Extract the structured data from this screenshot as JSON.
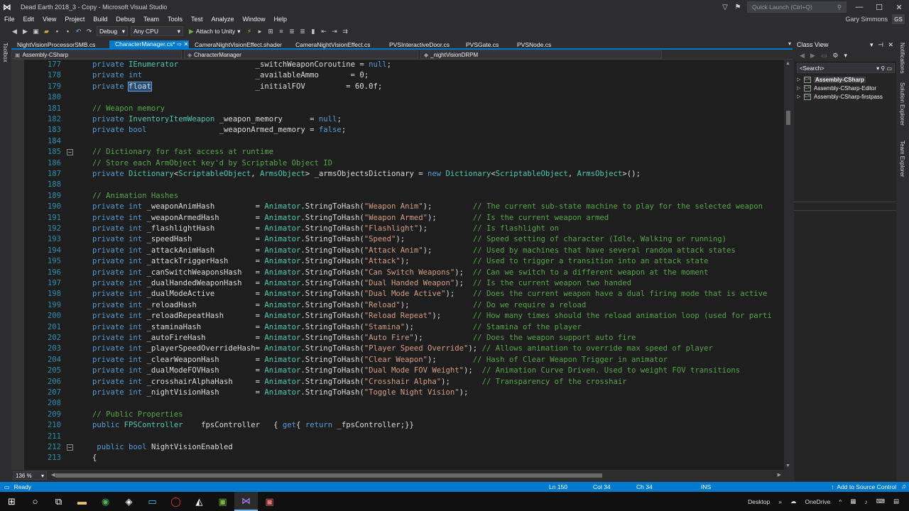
{
  "window": {
    "title": "Dead Earth 2018_3 - Copy - Microsoft Visual Studio",
    "quick_launch_placeholder": "Quick Launch (Ctrl+Q)",
    "user_name": "Gary Simmons",
    "user_initials": "GS"
  },
  "menu": [
    "File",
    "Edit",
    "View",
    "Project",
    "Build",
    "Debug",
    "Team",
    "Tools",
    "Test",
    "Analyze",
    "Window",
    "Help"
  ],
  "toolbar": {
    "config": "Debug",
    "platform": "Any CPU",
    "attach_label": "Attach to Unity"
  },
  "toolbox_label": "Toolbox",
  "tabs": [
    {
      "label": "NightVisionProcessorSMB.cs",
      "active": false
    },
    {
      "label": "CharacterManager.cs*  ⇨  ✕",
      "active": true
    },
    {
      "label": "CameraNightVisionEffect.shader",
      "active": false
    },
    {
      "label": "CameraNightVisionEffect.cs",
      "active": false
    },
    {
      "label": "PVSInteractiveDoor.cs",
      "active": false
    },
    {
      "label": "PVSGate.cs",
      "active": false
    },
    {
      "label": "PVSNode.cs",
      "active": false
    }
  ],
  "navbar": {
    "project": "Assembly-CSharp",
    "type": "CharacterManager",
    "member": "_nightVisionDRPM"
  },
  "code_lines": [
    {
      "n": "177",
      "segs": [
        [
          "kw",
          "private "
        ],
        [
          "tp",
          "IEnumerator"
        ],
        [
          "t",
          "                 _switchWeaponCoroutine = "
        ],
        [
          "kw",
          "null"
        ],
        [
          "t",
          ";"
        ]
      ]
    },
    {
      "n": "178",
      "segs": [
        [
          "kw",
          "private int"
        ],
        [
          "t",
          "                         _availableAmmo       = 0;"
        ]
      ]
    },
    {
      "n": "179",
      "segs": [
        [
          "kw",
          "private "
        ],
        [
          "sel",
          "float"
        ],
        [
          "t",
          "                       _initialFOV         = 60.0f;"
        ]
      ]
    },
    {
      "n": "180",
      "segs": []
    },
    {
      "n": "181",
      "segs": [
        [
          "cm",
          "// Weapon memory"
        ]
      ]
    },
    {
      "n": "182",
      "segs": [
        [
          "kw",
          "private "
        ],
        [
          "tp",
          "InventoryItemWeapon"
        ],
        [
          "t",
          " _weapon_memory      = "
        ],
        [
          "kw",
          "null"
        ],
        [
          "t",
          ";"
        ]
      ]
    },
    {
      "n": "183",
      "segs": [
        [
          "kw",
          "private bool"
        ],
        [
          "t",
          "                _weaponArmed_memory = "
        ],
        [
          "kw",
          "false"
        ],
        [
          "t",
          ";"
        ]
      ]
    },
    {
      "n": "184",
      "segs": []
    },
    {
      "n": "185",
      "fold": true,
      "segs": [
        [
          "cm",
          "// Dictionary for fast access at runtime"
        ]
      ]
    },
    {
      "n": "186",
      "segs": [
        [
          "cm",
          "// Store each ArmObject key'd by Scriptable Object ID"
        ]
      ]
    },
    {
      "n": "187",
      "segs": [
        [
          "kw",
          "private "
        ],
        [
          "tp",
          "Dictionary"
        ],
        [
          "t",
          "<"
        ],
        [
          "tp",
          "ScriptableObject"
        ],
        [
          "t",
          ", "
        ],
        [
          "tp",
          "ArmsObject"
        ],
        [
          "t",
          "> _armsObjectsDictionary = "
        ],
        [
          "kw",
          "new "
        ],
        [
          "tp",
          "Dictionary"
        ],
        [
          "t",
          "<"
        ],
        [
          "tp",
          "ScriptableObject"
        ],
        [
          "t",
          ", "
        ],
        [
          "tp",
          "ArmsObject"
        ],
        [
          "t",
          ">();"
        ]
      ]
    },
    {
      "n": "188",
      "segs": []
    },
    {
      "n": "189",
      "segs": [
        [
          "cm",
          "// Animation Hashes"
        ]
      ]
    },
    {
      "n": "190",
      "segs": [
        [
          "kw",
          "private int"
        ],
        [
          "t",
          " _weaponAnimHash         = "
        ],
        [
          "tp",
          "Animator"
        ],
        [
          "t",
          ".StringToHash("
        ],
        [
          "str",
          "\"Weapon Anim\""
        ],
        [
          "t",
          ");         "
        ],
        [
          "cm",
          "// The current sub-state machine to play for the selected weapon"
        ]
      ]
    },
    {
      "n": "191",
      "segs": [
        [
          "kw",
          "private int"
        ],
        [
          "t",
          " _weaponArmedHash        = "
        ],
        [
          "tp",
          "Animator"
        ],
        [
          "t",
          ".StringToHash("
        ],
        [
          "str",
          "\"Weapon Armed\""
        ],
        [
          "t",
          ");        "
        ],
        [
          "cm",
          "// Is the current weapon armed"
        ]
      ]
    },
    {
      "n": "192",
      "segs": [
        [
          "kw",
          "private int"
        ],
        [
          "t",
          " _flashlightHash         = "
        ],
        [
          "tp",
          "Animator"
        ],
        [
          "t",
          ".StringToHash("
        ],
        [
          "str",
          "\"Flashlight\""
        ],
        [
          "t",
          ");          "
        ],
        [
          "cm",
          "// Is flashlight on"
        ]
      ]
    },
    {
      "n": "193",
      "segs": [
        [
          "kw",
          "private int"
        ],
        [
          "t",
          " _speedHash              = "
        ],
        [
          "tp",
          "Animator"
        ],
        [
          "t",
          ".StringToHash("
        ],
        [
          "str",
          "\"Speed\""
        ],
        [
          "t",
          ");               "
        ],
        [
          "cm",
          "// Speed setting of character (Idle, Walking or running)"
        ]
      ]
    },
    {
      "n": "194",
      "segs": [
        [
          "kw",
          "private int"
        ],
        [
          "t",
          " _attackAnimHash         = "
        ],
        [
          "tp",
          "Animator"
        ],
        [
          "t",
          ".StringToHash("
        ],
        [
          "str",
          "\"Attack Anim\""
        ],
        [
          "t",
          ");         "
        ],
        [
          "cm",
          "// Used by machines that have several random attack states"
        ]
      ]
    },
    {
      "n": "195",
      "segs": [
        [
          "kw",
          "private int"
        ],
        [
          "t",
          " _attackTriggerHash      = "
        ],
        [
          "tp",
          "Animator"
        ],
        [
          "t",
          ".StringToHash("
        ],
        [
          "str",
          "\"Attack\""
        ],
        [
          "t",
          ");              "
        ],
        [
          "cm",
          "// Used to trigger a transition into an attack state"
        ]
      ]
    },
    {
      "n": "196",
      "segs": [
        [
          "kw",
          "private int"
        ],
        [
          "t",
          " _canSwitchWeaponsHash   = "
        ],
        [
          "tp",
          "Animator"
        ],
        [
          "t",
          ".StringToHash("
        ],
        [
          "str",
          "\"Can Switch Weapons\""
        ],
        [
          "t",
          ");  "
        ],
        [
          "cm",
          "// Can we switch to a different weapon at the moment"
        ]
      ]
    },
    {
      "n": "197",
      "segs": [
        [
          "kw",
          "private int"
        ],
        [
          "t",
          " _dualHandedWeaponHash   = "
        ],
        [
          "tp",
          "Animator"
        ],
        [
          "t",
          ".StringToHash("
        ],
        [
          "str",
          "\"Dual Handed Weapon\""
        ],
        [
          "t",
          ");  "
        ],
        [
          "cm",
          "// Is the current weapon two handed"
        ]
      ]
    },
    {
      "n": "198",
      "segs": [
        [
          "kw",
          "private int"
        ],
        [
          "t",
          " _dualModeActive         = "
        ],
        [
          "tp",
          "Animator"
        ],
        [
          "t",
          ".StringToHash("
        ],
        [
          "str",
          "\"Dual Mode Active\""
        ],
        [
          "t",
          ");    "
        ],
        [
          "cm",
          "// Does the current weapon have a dual firing mode that is active"
        ]
      ]
    },
    {
      "n": "199",
      "segs": [
        [
          "kw",
          "private int"
        ],
        [
          "t",
          " _reloadHash             = "
        ],
        [
          "tp",
          "Animator"
        ],
        [
          "t",
          ".StringToHash("
        ],
        [
          "str",
          "\"Reload\""
        ],
        [
          "t",
          ");              "
        ],
        [
          "cm",
          "// Do we require a reload"
        ]
      ]
    },
    {
      "n": "200",
      "segs": [
        [
          "kw",
          "private int"
        ],
        [
          "t",
          " _reloadRepeatHash       = "
        ],
        [
          "tp",
          "Animator"
        ],
        [
          "t",
          ".StringToHash("
        ],
        [
          "str",
          "\"Reload Repeat\""
        ],
        [
          "t",
          ");       "
        ],
        [
          "cm",
          "// How many times should the reload animation loop (used for parti"
        ]
      ]
    },
    {
      "n": "201",
      "segs": [
        [
          "kw",
          "private int"
        ],
        [
          "t",
          " _staminaHash            = "
        ],
        [
          "tp",
          "Animator"
        ],
        [
          "t",
          ".StringToHash("
        ],
        [
          "str",
          "\"Stamina\""
        ],
        [
          "t",
          ");             "
        ],
        [
          "cm",
          "// Stamina of the player"
        ]
      ]
    },
    {
      "n": "202",
      "segs": [
        [
          "kw",
          "private int"
        ],
        [
          "t",
          " _autoFireHash           = "
        ],
        [
          "tp",
          "Animator"
        ],
        [
          "t",
          ".StringToHash("
        ],
        [
          "str",
          "\"Auto Fire\""
        ],
        [
          "t",
          ");           "
        ],
        [
          "cm",
          "// Does the weapon support auto fire"
        ]
      ]
    },
    {
      "n": "203",
      "segs": [
        [
          "kw",
          "private int"
        ],
        [
          "t",
          " _playerSpeedOverrideHash= "
        ],
        [
          "tp",
          "Animator"
        ],
        [
          "t",
          ".StringToHash("
        ],
        [
          "str",
          "\"Player Speed Override\""
        ],
        [
          "t",
          "); "
        ],
        [
          "cm",
          "// Allows animation to override max speed of player"
        ]
      ]
    },
    {
      "n": "204",
      "segs": [
        [
          "kw",
          "private int"
        ],
        [
          "t",
          " _clearWeaponHash        = "
        ],
        [
          "tp",
          "Animator"
        ],
        [
          "t",
          ".StringToHash("
        ],
        [
          "str",
          "\"Clear Weapon\""
        ],
        [
          "t",
          ");        "
        ],
        [
          "cm",
          "// Hash of Clear Weapon Trigger in animator"
        ]
      ]
    },
    {
      "n": "205",
      "segs": [
        [
          "kw",
          "private int"
        ],
        [
          "t",
          " _dualModeFOVHash        = "
        ],
        [
          "tp",
          "Animator"
        ],
        [
          "t",
          ".StringToHash("
        ],
        [
          "str",
          "\"Dual Mode FOV Weight\""
        ],
        [
          "t",
          ");  "
        ],
        [
          "cm",
          "// Animation Curve Driven. Used to weight FOV transitions"
        ]
      ]
    },
    {
      "n": "206",
      "segs": [
        [
          "kw",
          "private int"
        ],
        [
          "t",
          " _crosshairAlphaHash     = "
        ],
        [
          "tp",
          "Animator"
        ],
        [
          "t",
          ".StringToHash("
        ],
        [
          "str",
          "\"Crosshair Alpha\""
        ],
        [
          "t",
          ");       "
        ],
        [
          "cm",
          "// Transparency of the crosshair"
        ]
      ]
    },
    {
      "n": "207",
      "segs": [
        [
          "kw",
          "private int"
        ],
        [
          "t",
          " _nightVisionHash        = "
        ],
        [
          "tp",
          "Animator"
        ],
        [
          "t",
          ".StringToHash("
        ],
        [
          "str",
          "\"Toggle Night Vision\""
        ],
        [
          "t",
          ");"
        ]
      ]
    },
    {
      "n": "208",
      "segs": []
    },
    {
      "n": "209",
      "segs": [
        [
          "cm",
          "// Public Properties"
        ]
      ]
    },
    {
      "n": "210",
      "segs": [
        [
          "kw",
          "public "
        ],
        [
          "tp",
          "FPSController"
        ],
        [
          "t",
          "    fpsController   { "
        ],
        [
          "kw",
          "get"
        ],
        [
          "t",
          "{ "
        ],
        [
          "kw",
          "return"
        ],
        [
          "t",
          " _fpsController;}}"
        ]
      ]
    },
    {
      "n": "211",
      "segs": []
    },
    {
      "n": "212",
      "fold": true,
      "segs": [
        [
          "t",
          " "
        ],
        [
          "kw",
          "public bool"
        ],
        [
          "t",
          " NightVisionEnabled"
        ]
      ]
    },
    {
      "n": "213",
      "segs": [
        [
          "t",
          "{"
        ]
      ]
    }
  ],
  "zoom": "136 %",
  "class_view": {
    "title": "Class View",
    "search_placeholder": "<Search>",
    "items": [
      {
        "label": "Assembly-CSharp",
        "selected": true
      },
      {
        "label": "Assembly-CSharp-Editor",
        "selected": false
      },
      {
        "label": "Assembly-CSharp-firstpass",
        "selected": false
      }
    ]
  },
  "side_labels": [
    "Notifications",
    "Solution Explorer",
    "Team Explorer"
  ],
  "status": {
    "ready": "Ready",
    "ln": "Ln 150",
    "col": "Col 34",
    "ch": "Ch 34",
    "ins": "INS",
    "source_control": "Add to Source Control"
  },
  "taskbar": {
    "desktop": "Desktop",
    "onedrive": "OneDrive"
  },
  "colors": {
    "accent": "#007acc",
    "keyword": "#569cd6",
    "type": "#4ec9b0",
    "string": "#d69d85",
    "comment": "#57a64a"
  }
}
